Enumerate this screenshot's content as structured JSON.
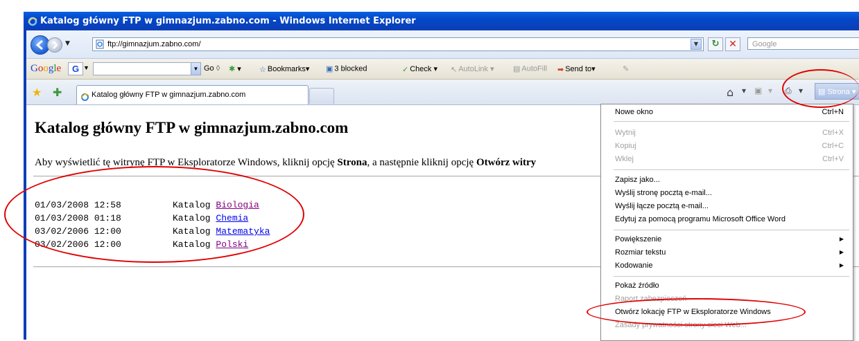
{
  "window": {
    "title": "Katalog główny FTP w gimnazjum.zabno.com - Windows Internet Explorer"
  },
  "address_bar": {
    "url": "ftp://gimnazjum.zabno.com/",
    "search_placeholder": "Google"
  },
  "google_toolbar": {
    "logo": "Google",
    "go_label": "Go",
    "bookmarks_label": "Bookmarks",
    "blocked_label": "3 blocked",
    "check_label": "Check",
    "autolink_label": "AutoLink",
    "autofill_label": "AutoFill",
    "sendto_label": "Send to"
  },
  "tabs": [
    {
      "label": "Katalog główny FTP w gimnazjum.zabno.com"
    }
  ],
  "command_bar": {
    "page_label": "Strona"
  },
  "page": {
    "title": "Katalog główny FTP w gimnazjum.zabno.com",
    "intro_part1": "Aby wyświetlić tę witrynę FTP w Eksploratorze Windows, kliknij opcję ",
    "intro_bold1": "Strona",
    "intro_part2": ", a następnie kliknij opcję ",
    "intro_bold2": "Otwórz witry",
    "listing": [
      {
        "datetime": "01/03/2008 12:58",
        "type": "Katalog",
        "name": "Biologia",
        "visited": true
      },
      {
        "datetime": "01/03/2008 01:18",
        "type": "Katalog",
        "name": "Chemia",
        "visited": false
      },
      {
        "datetime": "03/02/2006 12:00",
        "type": "Katalog",
        "name": "Matematyka",
        "visited": false
      },
      {
        "datetime": "03/02/2006 12:00",
        "type": "Katalog",
        "name": "Polski",
        "visited": true
      }
    ]
  },
  "menu": {
    "items": [
      {
        "label": "Nowe okno",
        "shortcut": "Ctrl+N",
        "disabled": false
      },
      {
        "label": "Wytnij",
        "shortcut": "Ctrl+X",
        "disabled": true
      },
      {
        "label": "Kopiuj",
        "shortcut": "Ctrl+C",
        "disabled": true
      },
      {
        "label": "Wklej",
        "shortcut": "Ctrl+V",
        "disabled": true
      },
      {
        "label": "Zapisz jako...",
        "disabled": false
      },
      {
        "label": "Wyślij stronę pocztą e-mail...",
        "disabled": false
      },
      {
        "label": "Wyślij łącze pocztą e-mail...",
        "disabled": false
      },
      {
        "label": "Edytuj za pomocą programu Microsoft Office Word",
        "disabled": false
      },
      {
        "label": "Powiększenie",
        "submenu": true,
        "disabled": false
      },
      {
        "label": "Rozmiar tekstu",
        "submenu": true,
        "disabled": false
      },
      {
        "label": "Kodowanie",
        "submenu": true,
        "disabled": false
      },
      {
        "label": "Pokaż źródło",
        "disabled": false
      },
      {
        "label": "Raport zabezpieczeń",
        "disabled": true
      },
      {
        "label": "Otwórz lokację FTP w Eksploratorze Windows",
        "disabled": false
      },
      {
        "label": "Zasady prywatności strony sieci Web...",
        "disabled": true
      }
    ]
  },
  "colors": {
    "titlebar": "#0447c7",
    "annotation": "#e00000",
    "visited_link": "#800080",
    "link": "#0000ee"
  }
}
